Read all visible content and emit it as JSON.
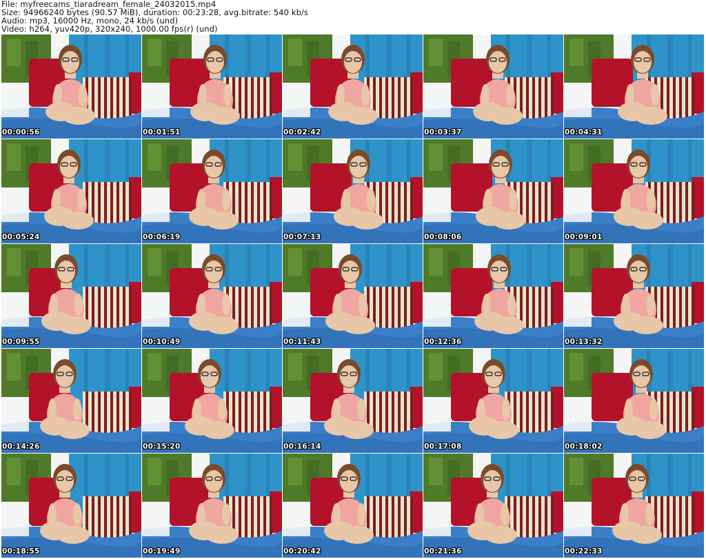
{
  "header": {
    "file_line": "File: myfreecams_tiaradream_female_24032015.mp4",
    "size_line": "Size: 94966240 bytes (90.57 MiB), duration: 00:23:28, avg.bitrate: 540 kb/s",
    "audio_line": "Audio: mp3, 16000 Hz, mono, 24 kb/s (und)",
    "video_line": "Video: h264, yuv420p, 320x240, 1000.00 fps(r) (und)"
  },
  "thumbnails": [
    {
      "timestamp": "00:00:56"
    },
    {
      "timestamp": "00:01:51"
    },
    {
      "timestamp": "00:02:42"
    },
    {
      "timestamp": "00:03:37"
    },
    {
      "timestamp": "00:04:31"
    },
    {
      "timestamp": "00:05:24"
    },
    {
      "timestamp": "00:06:19"
    },
    {
      "timestamp": "00:07:13"
    },
    {
      "timestamp": "00:08:06"
    },
    {
      "timestamp": "00:09:01"
    },
    {
      "timestamp": "00:09:55"
    },
    {
      "timestamp": "00:10:49"
    },
    {
      "timestamp": "00:11:43"
    },
    {
      "timestamp": "00:12:36"
    },
    {
      "timestamp": "00:13:32"
    },
    {
      "timestamp": "00:14:26"
    },
    {
      "timestamp": "00:15:20"
    },
    {
      "timestamp": "00:16:14"
    },
    {
      "timestamp": "00:17:08"
    },
    {
      "timestamp": "00:18:02"
    },
    {
      "timestamp": "00:18:55"
    },
    {
      "timestamp": "00:19:49"
    },
    {
      "timestamp": "00:20:42"
    },
    {
      "timestamp": "00:21:36"
    },
    {
      "timestamp": "00:22:33"
    }
  ],
  "colors": {
    "curtain": "#2e93c9",
    "wall": "#f4f6f6",
    "cushion_red": "#b3122a",
    "stripe_cream": "#ece2c8",
    "stripe_maroon": "#7a1e22",
    "blanket": "#3a7fc8",
    "skin": "#e8c6a8",
    "top": "#f0a6a0",
    "hair": "#7a4a2a",
    "plant": "#4f7a2a"
  }
}
